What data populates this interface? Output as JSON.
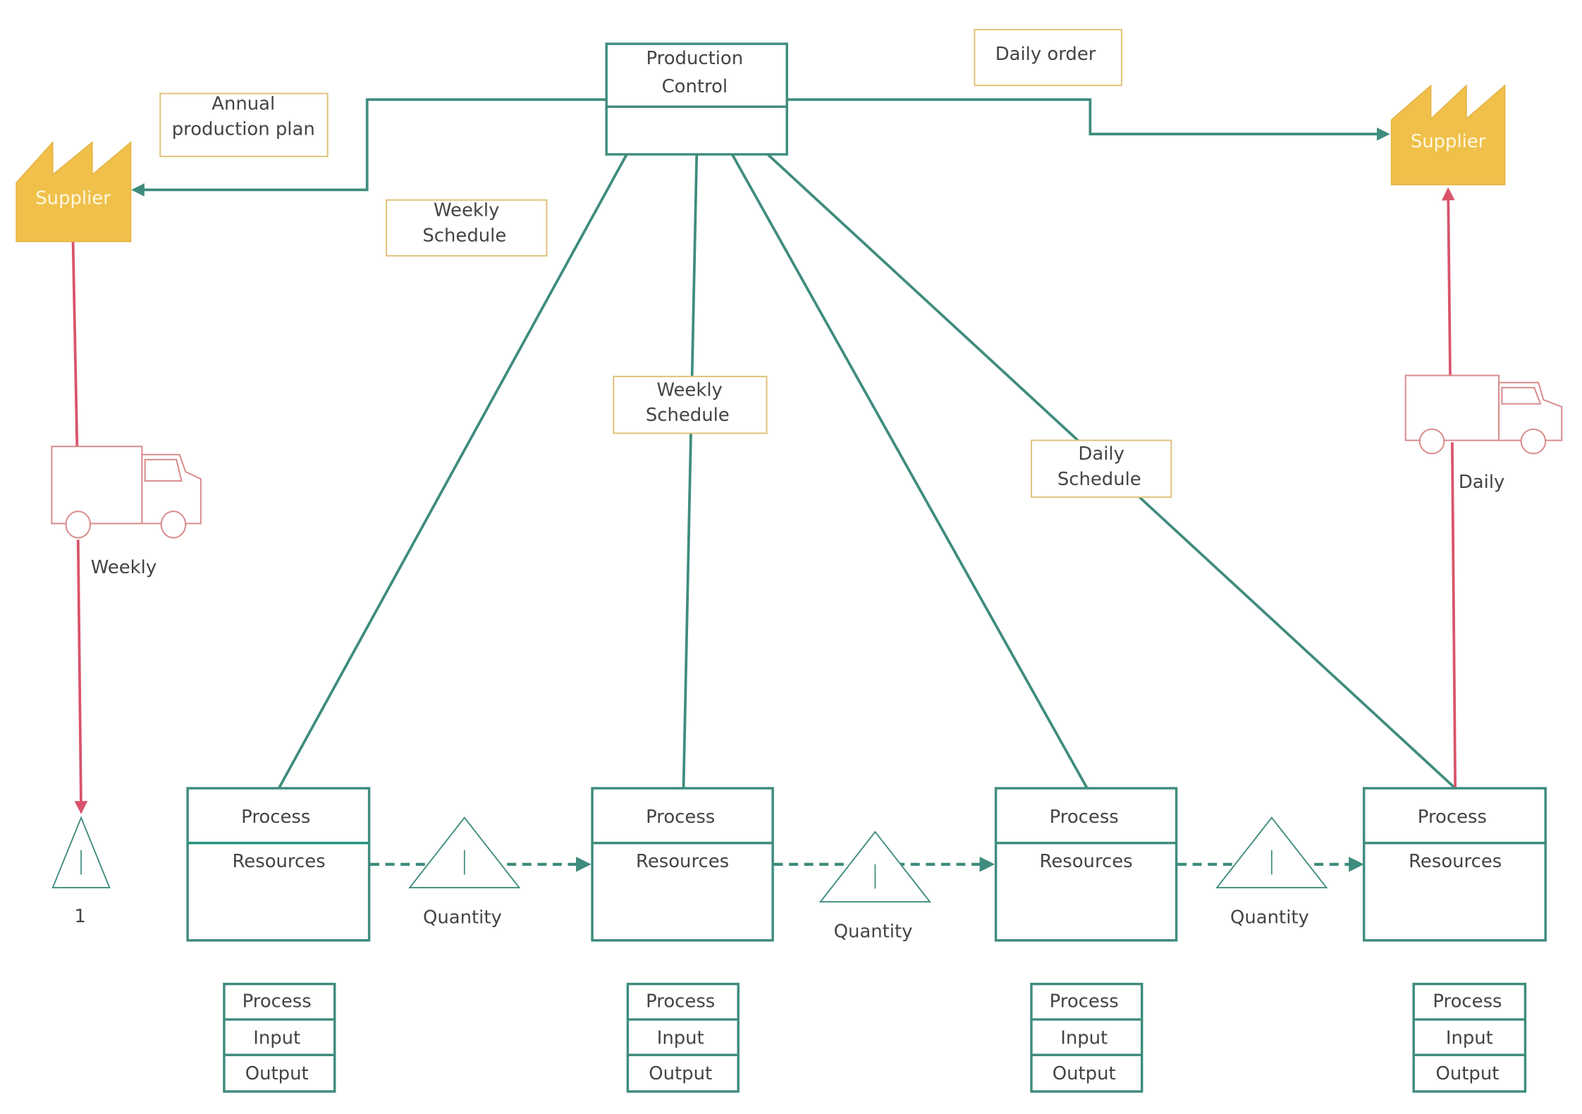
{
  "colors": {
    "teal": "#3f8c7e",
    "supplier_fill": "#f0c04b",
    "supply_red": "#d9536b",
    "note_border": "#e0c27a",
    "truck_stroke": "#d98b8b",
    "text": "#444444"
  },
  "production_control": {
    "title_line1": "Production",
    "title_line2": "Control"
  },
  "notes": {
    "annual_line1": "Annual",
    "annual_line2": "production plan",
    "weekly_left_line1": "Weekly",
    "weekly_left_line2": "Schedule",
    "weekly_center_line1": "Weekly",
    "weekly_center_line2": "Schedule",
    "daily_order": "Daily order",
    "daily_schedule_line1": "Daily",
    "daily_schedule_line2": "Schedule"
  },
  "suppliers": {
    "left": "Supplier",
    "right": "Supplier"
  },
  "shipments": {
    "left_frequency": "Weekly",
    "right_frequency": "Daily"
  },
  "inventory_start": {
    "label": "1"
  },
  "processes": [
    {
      "title": "Process",
      "body": "Resources"
    },
    {
      "title": "Process",
      "body": "Resources"
    },
    {
      "title": "Process",
      "body": "Resources"
    },
    {
      "title": "Process",
      "body": "Resources"
    }
  ],
  "inventories": [
    {
      "label": "Quantity"
    },
    {
      "label": "Quantity"
    },
    {
      "label": "Quantity"
    }
  ],
  "data_tables": [
    {
      "rows": [
        "Process",
        "Input",
        "Output"
      ]
    },
    {
      "rows": [
        "Process",
        "Input",
        "Output"
      ]
    },
    {
      "rows": [
        "Process",
        "Input",
        "Output"
      ]
    },
    {
      "rows": [
        "Process",
        "Input",
        "Output"
      ]
    }
  ]
}
